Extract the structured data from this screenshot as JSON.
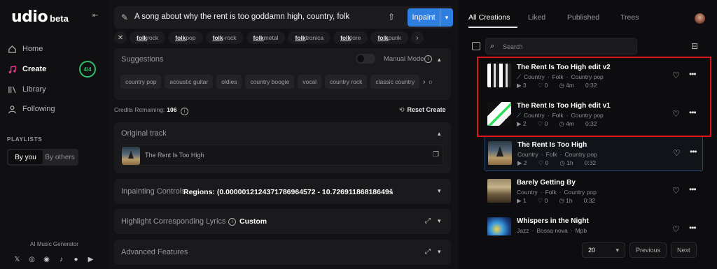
{
  "sidebar": {
    "logo": "udio",
    "logo_suffix": "beta",
    "nav": [
      {
        "label": "Home",
        "icon": "home-icon"
      },
      {
        "label": "Create",
        "icon": "music-note-icon"
      },
      {
        "label": "Library",
        "icon": "library-icon"
      },
      {
        "label": "Following",
        "icon": "user-icon"
      }
    ],
    "create_badge": "4/4",
    "playlists_title": "PLAYLISTS",
    "playlist_tabs": [
      "By you",
      "By others"
    ],
    "footer_text": "AI Music Generator",
    "socials": [
      "twitter-icon",
      "instagram-icon",
      "discord-icon",
      "tiktok-icon",
      "reddit-icon",
      "youtube-icon"
    ]
  },
  "prompt": {
    "text": "A song about why the rent is too goddamn high, country, folk",
    "button": "Inpaint"
  },
  "genre_chips": [
    {
      "bold": "folk",
      "rest": " rock"
    },
    {
      "bold": "folk",
      "rest": " pop"
    },
    {
      "bold": "folk",
      "rest": "-rock"
    },
    {
      "bold": "folk",
      "rest": " metal"
    },
    {
      "bold": "folk",
      "rest": "tronica"
    },
    {
      "bold": "folk",
      "rest": "lore"
    },
    {
      "bold": "folk",
      "rest": " punk"
    }
  ],
  "suggestions": {
    "title": "Suggestions",
    "manual_mode": "Manual Mode",
    "chips": [
      "country pop",
      "acoustic guitar",
      "oldies",
      "country boogie",
      "vocal",
      "country rock",
      "classic country"
    ],
    "overflow_chip": "o"
  },
  "credits": {
    "label": "Credits Remaining:",
    "value": "106",
    "reset": "Reset Create"
  },
  "original_track": {
    "title": "Original track",
    "track_name": "The Rent Is Too High"
  },
  "inpainting": {
    "title": "Inpainting Controls",
    "regions": "Regions: (0.0000012124371786964572 - 10.72691186818649š"
  },
  "highlight": {
    "title": "Highlight Corresponding Lyrics",
    "value": "Custom"
  },
  "advanced": {
    "title": "Advanced Features"
  },
  "right": {
    "tabs": [
      "All Creations",
      "Liked",
      "Published",
      "Trees"
    ],
    "search_placeholder": "Search",
    "songs": [
      {
        "title": "The Rent Is Too High edit v2",
        "genres": [
          "Country",
          "Folk",
          "Country pop"
        ],
        "plays": "3",
        "likes": "0",
        "age": "4m",
        "duration": "0:32"
      },
      {
        "title": "The Rent Is Too High edit v1",
        "genres": [
          "Country",
          "Folk",
          "Country pop"
        ],
        "plays": "2",
        "likes": "0",
        "age": "4m",
        "duration": "0:32"
      },
      {
        "title": "The Rent Is Too High",
        "genres": [
          "Country",
          "Folk",
          "Country pop"
        ],
        "plays": "2",
        "likes": "0",
        "age": "1h",
        "duration": "0:32"
      },
      {
        "title": "Barely Getting By",
        "genres": [
          "Country",
          "Folk",
          "Country pop"
        ],
        "plays": "1",
        "likes": "0",
        "age": "1h",
        "duration": "0:32"
      },
      {
        "title": "Whispers in the Night",
        "genres": [
          "Jazz",
          "Bossa nova",
          "Mpb"
        ],
        "plays": "",
        "likes": "",
        "age": "",
        "duration": ""
      }
    ],
    "page_size": "20",
    "prev": "Previous",
    "next": "Next"
  },
  "colors": {
    "accent_blue": "#2f7fe0",
    "create_pink": "#e8348a",
    "badge_green": "#2fbf6a",
    "highlight_red": "#e0141c"
  }
}
